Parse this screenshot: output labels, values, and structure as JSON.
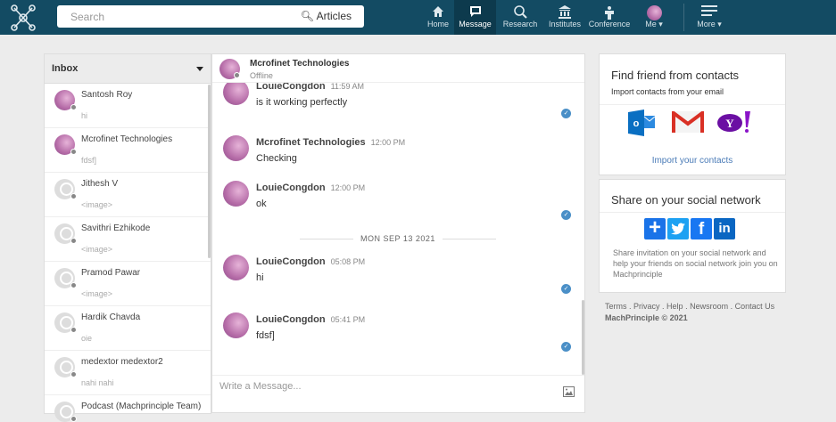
{
  "nav": {
    "search_placeholder": "Search",
    "search_scope": "Articles",
    "items": [
      {
        "label": "Home",
        "icon": "home-icon"
      },
      {
        "label": "Message",
        "icon": "message-icon",
        "active": true
      },
      {
        "label": "Research",
        "icon": "research-icon"
      },
      {
        "label": "Institutes",
        "icon": "institutes-icon"
      },
      {
        "label": "Conference",
        "icon": "conference-icon"
      },
      {
        "label": "Me",
        "icon": "avatar"
      },
      {
        "label": "More",
        "icon": "menu-icon"
      }
    ]
  },
  "inbox": {
    "title": "Inbox",
    "conversations": [
      {
        "name": "Santosh Roy",
        "preview": "hi",
        "photo": true
      },
      {
        "name": "Mcrofinet Technologies",
        "preview": "fdsf]",
        "photo": true
      },
      {
        "name": "Jithesh V",
        "preview": "<image>",
        "photo": false
      },
      {
        "name": "Savithri Ezhikode",
        "preview": "<image>",
        "photo": false
      },
      {
        "name": "Pramod Pawar",
        "preview": "<image>",
        "photo": false
      },
      {
        "name": "Hardik Chavda",
        "preview": "oie",
        "photo": false
      },
      {
        "name": "medextor medextor2",
        "preview": "nahi nahi",
        "photo": false
      },
      {
        "name": "Podcast (Machprinciple Team)",
        "preview": "",
        "photo": false
      }
    ]
  },
  "chat": {
    "contact": "Mcrofinet Technologies",
    "status": "Offline",
    "date_divider": "MON SEP 13 2021",
    "input_placeholder": "Write a Message...",
    "messages": [
      {
        "sender": "LouieCongdon",
        "time": "11:59 AM",
        "text": "is it working perfectly",
        "read": true
      },
      {
        "sender": "Mcrofinet Technologies",
        "time": "12:00 PM",
        "text": "Checking",
        "read": false
      },
      {
        "sender": "LouieCongdon",
        "time": "12:00 PM",
        "text": "ok",
        "read": true
      },
      {
        "sender": "LouieCongdon",
        "time": "05:08 PM",
        "text": "hi",
        "read": true
      },
      {
        "sender": "LouieCongdon",
        "time": "05:41 PM",
        "text": "fdsf]",
        "read": true
      }
    ]
  },
  "contacts": {
    "title": "Find friend from contacts",
    "subtitle": "Import contacts from your email",
    "link": "Import your contacts",
    "providers": [
      "Outlook",
      "Gmail",
      "Yahoo"
    ]
  },
  "share": {
    "title": "Share on your social network",
    "text": "Share invitation on your social network and help your friends on social network join you on Machprinciple",
    "networks": [
      "Share",
      "Twitter",
      "Facebook",
      "LinkedIn"
    ]
  },
  "footer": {
    "links": [
      "Terms",
      "Privacy",
      "Help",
      "Newsroom",
      "Contact Us"
    ],
    "copyright": "MachPrinciple © 2021"
  }
}
